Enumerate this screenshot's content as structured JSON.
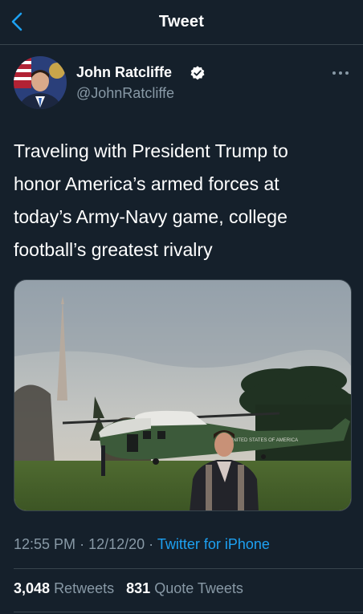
{
  "header": {
    "title": "Tweet",
    "back_icon": "chevron-left-icon"
  },
  "author": {
    "name": "John Ratcliffe",
    "handle": "@JohnRatcliffe",
    "verified_icon": "verified-badge-icon"
  },
  "tweet": {
    "lines": [
      "Traveling with President Trump to",
      "honor America’s armed forces at",
      "today’s Army-Navy game, college",
      "football’s greatest rivalry"
    ],
    "time": "12:55 PM",
    "date": "12/12/20",
    "source": "Twitter for iPhone",
    "separator": "·"
  },
  "media": {
    "helicopter_text": "UNITED STATES OF AMERICA"
  },
  "stats": {
    "retweets_count": "3,048",
    "retweets_label": "Retweets",
    "quotes_count": "831",
    "quotes_label": "Quote Tweets"
  },
  "colors": {
    "background": "#15202b",
    "accent": "#1da1f2",
    "muted": "#8899a6",
    "border": "#38444d"
  }
}
